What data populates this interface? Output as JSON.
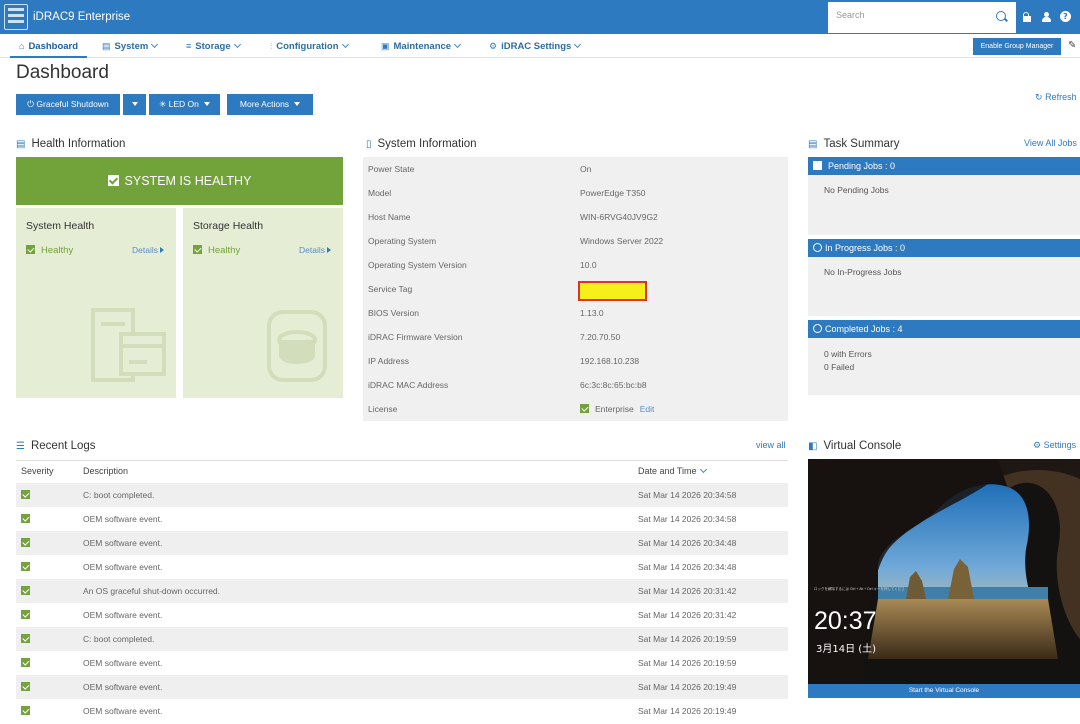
{
  "header": {
    "app_title": "iDRAC9  Enterprise",
    "search_placeholder": "Search",
    "icons": [
      "server-logo-icon",
      "search-icon",
      "lock-icon",
      "user-icon",
      "help-icon"
    ],
    "help_glyph": "?"
  },
  "nav": {
    "items": [
      {
        "label": "Dashboard",
        "icon": "home-icon",
        "glyph": "⌂"
      },
      {
        "label": "System",
        "icon": "system-icon",
        "glyph": "▤"
      },
      {
        "label": "Storage",
        "icon": "storage-icon",
        "glyph": "≡"
      },
      {
        "label": "Configuration",
        "icon": "configuration-icon",
        "glyph": "⫶"
      },
      {
        "label": "Maintenance",
        "icon": "maintenance-icon",
        "glyph": "▣"
      },
      {
        "label": "iDRAC Settings",
        "icon": "settings-icon",
        "glyph": "⚙"
      }
    ],
    "group_manager_label": "Enable Group Manager",
    "pin_glyph": "✎"
  },
  "page": {
    "title": "Dashboard"
  },
  "actions": {
    "graceful_shutdown": "Graceful Shutdown",
    "power_glyph": "⏻",
    "led_on": "LED On",
    "led_glyph": "✳",
    "more_actions": "More Actions",
    "refresh": "Refresh",
    "refresh_glyph": "↻"
  },
  "health": {
    "title": "Health Information",
    "icon_glyph": "▤",
    "banner": "SYSTEM IS HEALTHY",
    "system": {
      "title": "System Health",
      "status": "Healthy",
      "details": "Details"
    },
    "storage": {
      "title": "Storage Health",
      "status": "Healthy",
      "details": "Details"
    },
    "color_healthy": "#72a23a"
  },
  "system_info": {
    "title": "System Information",
    "icon_glyph": "▯",
    "rows": [
      {
        "label": "Power State",
        "value": "On"
      },
      {
        "label": "Model",
        "value": "PowerEdge T350"
      },
      {
        "label": "Host Name",
        "value": "WIN-6RVG40JV9G2"
      },
      {
        "label": "Operating System",
        "value": "Windows Server 2022"
      },
      {
        "label": "Operating System Version",
        "value": "10.0"
      },
      {
        "label": "Service Tag",
        "value": ""
      },
      {
        "label": "BIOS Version",
        "value": "1.13.0"
      },
      {
        "label": "iDRAC Firmware Version",
        "value": "7.20.70.50"
      },
      {
        "label": "IP Address",
        "value": "192.168.10.238"
      },
      {
        "label": "iDRAC MAC Address",
        "value": "6c:3c:8c:65:bc:b8"
      },
      {
        "label": "License",
        "value": "Enterprise",
        "edit": "Edit"
      }
    ]
  },
  "task_summary": {
    "title": "Task Summary",
    "icon_glyph": "▤",
    "view_all": "View All Jobs",
    "pending_title": "Pending Jobs : 0",
    "pending_text": "No Pending Jobs",
    "progress_title": "In Progress Jobs : 0",
    "progress_text": "No In-Progress Jobs",
    "completed_title": "Completed Jobs : 4",
    "completed_errors": "0  with Errors",
    "completed_failed": "0  Failed"
  },
  "logs": {
    "title": "Recent Logs",
    "icon_glyph": "☰",
    "view_all": "view all",
    "columns": {
      "severity": "Severity",
      "description": "Description",
      "date": "Date and Time"
    },
    "rows": [
      {
        "description": "C: boot completed.",
        "date": "Sat Mar 14 2026 20:34:58"
      },
      {
        "description": "OEM software event.",
        "date": "Sat Mar 14 2026 20:34:58"
      },
      {
        "description": "OEM software event.",
        "date": "Sat Mar 14 2026 20:34:48"
      },
      {
        "description": "OEM software event.",
        "date": "Sat Mar 14 2026 20:34:48"
      },
      {
        "description": "An OS graceful shut-down occurred.",
        "date": "Sat Mar 14 2026 20:31:42"
      },
      {
        "description": "OEM software event.",
        "date": "Sat Mar 14 2026 20:31:42"
      },
      {
        "description": "C: boot completed.",
        "date": "Sat Mar 14 2026 20:19:59"
      },
      {
        "description": "OEM software event.",
        "date": "Sat Mar 14 2026 20:19:59"
      },
      {
        "description": "OEM software event.",
        "date": "Sat Mar 14 2026 20:19:49"
      },
      {
        "description": "OEM software event.",
        "date": "Sat Mar 14 2026 20:19:49"
      }
    ]
  },
  "virtual_console": {
    "title": "Virtual Console",
    "icon_glyph": "◧",
    "settings": "Settings",
    "settings_glyph": "⚙",
    "lock_hint": "ロックを解除するには Ctrl + Alt + Del キーを押してください",
    "time": "20:37",
    "date": "3月14日 (土)",
    "launch": "Start the Virtual Console"
  }
}
